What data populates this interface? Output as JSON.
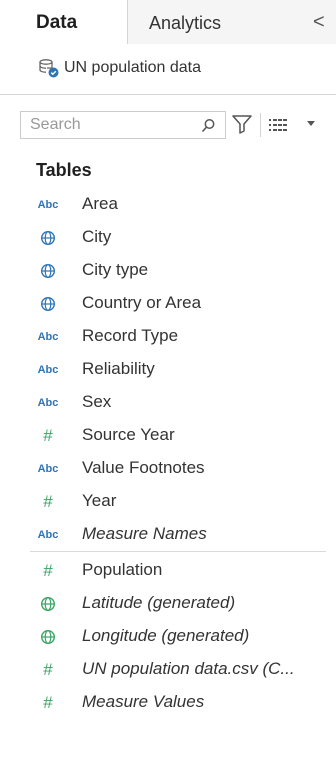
{
  "tabs": {
    "data_label": "Data",
    "analytics_label": "Analytics",
    "collapse_glyph": "<"
  },
  "datasource": {
    "icon": "datasource-icon",
    "name": "UN population data"
  },
  "search": {
    "placeholder": "Search",
    "value": ""
  },
  "toolbar": {
    "filter_icon": "filter-icon",
    "view_icon": "list-view-icon",
    "dropdown_icon": "dropdown-arrow-icon"
  },
  "tables": {
    "heading": "Tables",
    "dimensions": [
      {
        "type": "Abc",
        "icon": "string-type-icon",
        "name": "Area",
        "italic": false
      },
      {
        "type": "globe",
        "icon": "geographic-role-icon",
        "name": "City",
        "italic": false
      },
      {
        "type": "globe",
        "icon": "geographic-role-icon",
        "name": "City type",
        "italic": false
      },
      {
        "type": "globe",
        "icon": "geographic-role-icon",
        "name": "Country or Area",
        "italic": false
      },
      {
        "type": "Abc",
        "icon": "string-type-icon",
        "name": "Record Type",
        "italic": false
      },
      {
        "type": "Abc",
        "icon": "string-type-icon",
        "name": "Reliability",
        "italic": false
      },
      {
        "type": "Abc",
        "icon": "string-type-icon",
        "name": "Sex",
        "italic": false
      },
      {
        "type": "#",
        "icon": "number-type-icon",
        "name": "Source Year",
        "italic": false
      },
      {
        "type": "Abc",
        "icon": "string-type-icon",
        "name": "Value Footnotes",
        "italic": false
      },
      {
        "type": "#",
        "icon": "number-type-icon",
        "name": "Year",
        "italic": false
      },
      {
        "type": "Abc",
        "icon": "string-type-icon",
        "name": "Measure Names",
        "italic": true
      }
    ],
    "measures": [
      {
        "type": "#",
        "icon": "number-type-icon",
        "name": "Population",
        "italic": false
      },
      {
        "type": "globe",
        "icon": "geographic-role-icon",
        "name": "Latitude (generated)",
        "italic": true
      },
      {
        "type": "globe",
        "icon": "geographic-role-icon",
        "name": "Longitude (generated)",
        "italic": true
      },
      {
        "type": "#",
        "icon": "number-type-icon",
        "name": "UN population data.csv (C...",
        "italic": true
      },
      {
        "type": "#",
        "icon": "number-type-icon",
        "name": "Measure Values",
        "italic": true
      }
    ]
  },
  "colors": {
    "dimension_blue": "#2f74b5",
    "measure_green": "#3aa564",
    "tab_inactive_bg": "#f5f5f5",
    "border": "#d4d4d4"
  }
}
